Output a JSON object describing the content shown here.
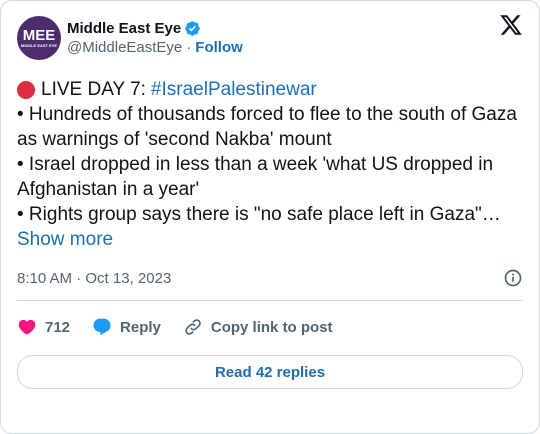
{
  "author": {
    "name": "Middle East Eye",
    "handle": "@MiddleEastEye",
    "follow_label": "Follow",
    "avatar_mark": "MEE",
    "avatar_sub": "MIDDLE EAST EYE",
    "verified_color": "#1d9bf0",
    "avatar_color": "#4b2d6e"
  },
  "tweet": {
    "live_prefix": "LIVE DAY 7:",
    "hashtag": "#IsraelPalestinewar",
    "bullet1": "• Hundreds of thousands forced to flee to the south of Gaza as warnings of 'second Nakba' mount",
    "bullet2": " • Israel dropped in less than a week 'what US dropped in Afghanistan in a year'",
    "bullet3": "• Rights group says there is \"no safe place left in Gaza\"…",
    "show_more": "Show more",
    "link_color": "#1d6fb0"
  },
  "meta": {
    "time": "8:10 AM",
    "separator": "·",
    "date": "Oct 13, 2023"
  },
  "actions": {
    "like_count": "712",
    "reply_label": "Reply",
    "copy_label": "Copy link to post",
    "like_color": "#f91880",
    "reply_color": "#1d9bf0"
  },
  "footer": {
    "read_replies": "Read 42 replies"
  },
  "icons": [
    "x-logo-icon",
    "verified-badge-icon",
    "red-circle-icon",
    "info-icon",
    "heart-icon",
    "reply-bubble-icon",
    "link-icon"
  ]
}
